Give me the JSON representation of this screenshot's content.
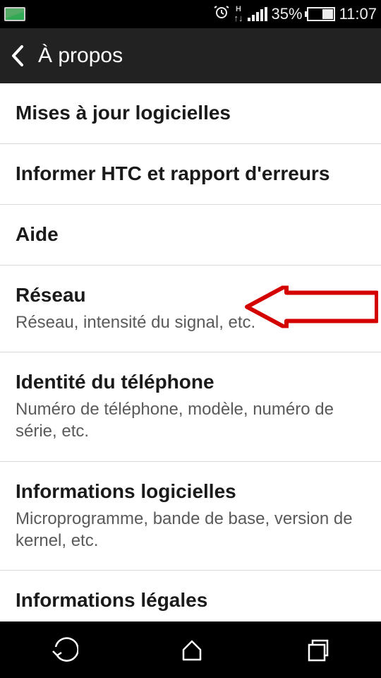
{
  "status": {
    "battery_pct": "35%",
    "clock": "11:07",
    "data_label": "H"
  },
  "header": {
    "title": "À propos"
  },
  "items": [
    {
      "title": "Mises à jour logicielles",
      "sub": ""
    },
    {
      "title": "Informer HTC et rapport d'erreurs",
      "sub": ""
    },
    {
      "title": "Aide",
      "sub": ""
    },
    {
      "title": "Réseau",
      "sub": "Réseau, intensité du signal, etc."
    },
    {
      "title": "Identité du téléphone",
      "sub": "Numéro de téléphone, modèle, numéro de série, etc."
    },
    {
      "title": "Informations logicielles",
      "sub": "Microprogramme, bande de base, version de kernel, etc."
    },
    {
      "title": "Informations légales",
      "sub": ""
    }
  ],
  "annotation": {
    "points_to_item_index": 3,
    "color": "#d40000"
  }
}
